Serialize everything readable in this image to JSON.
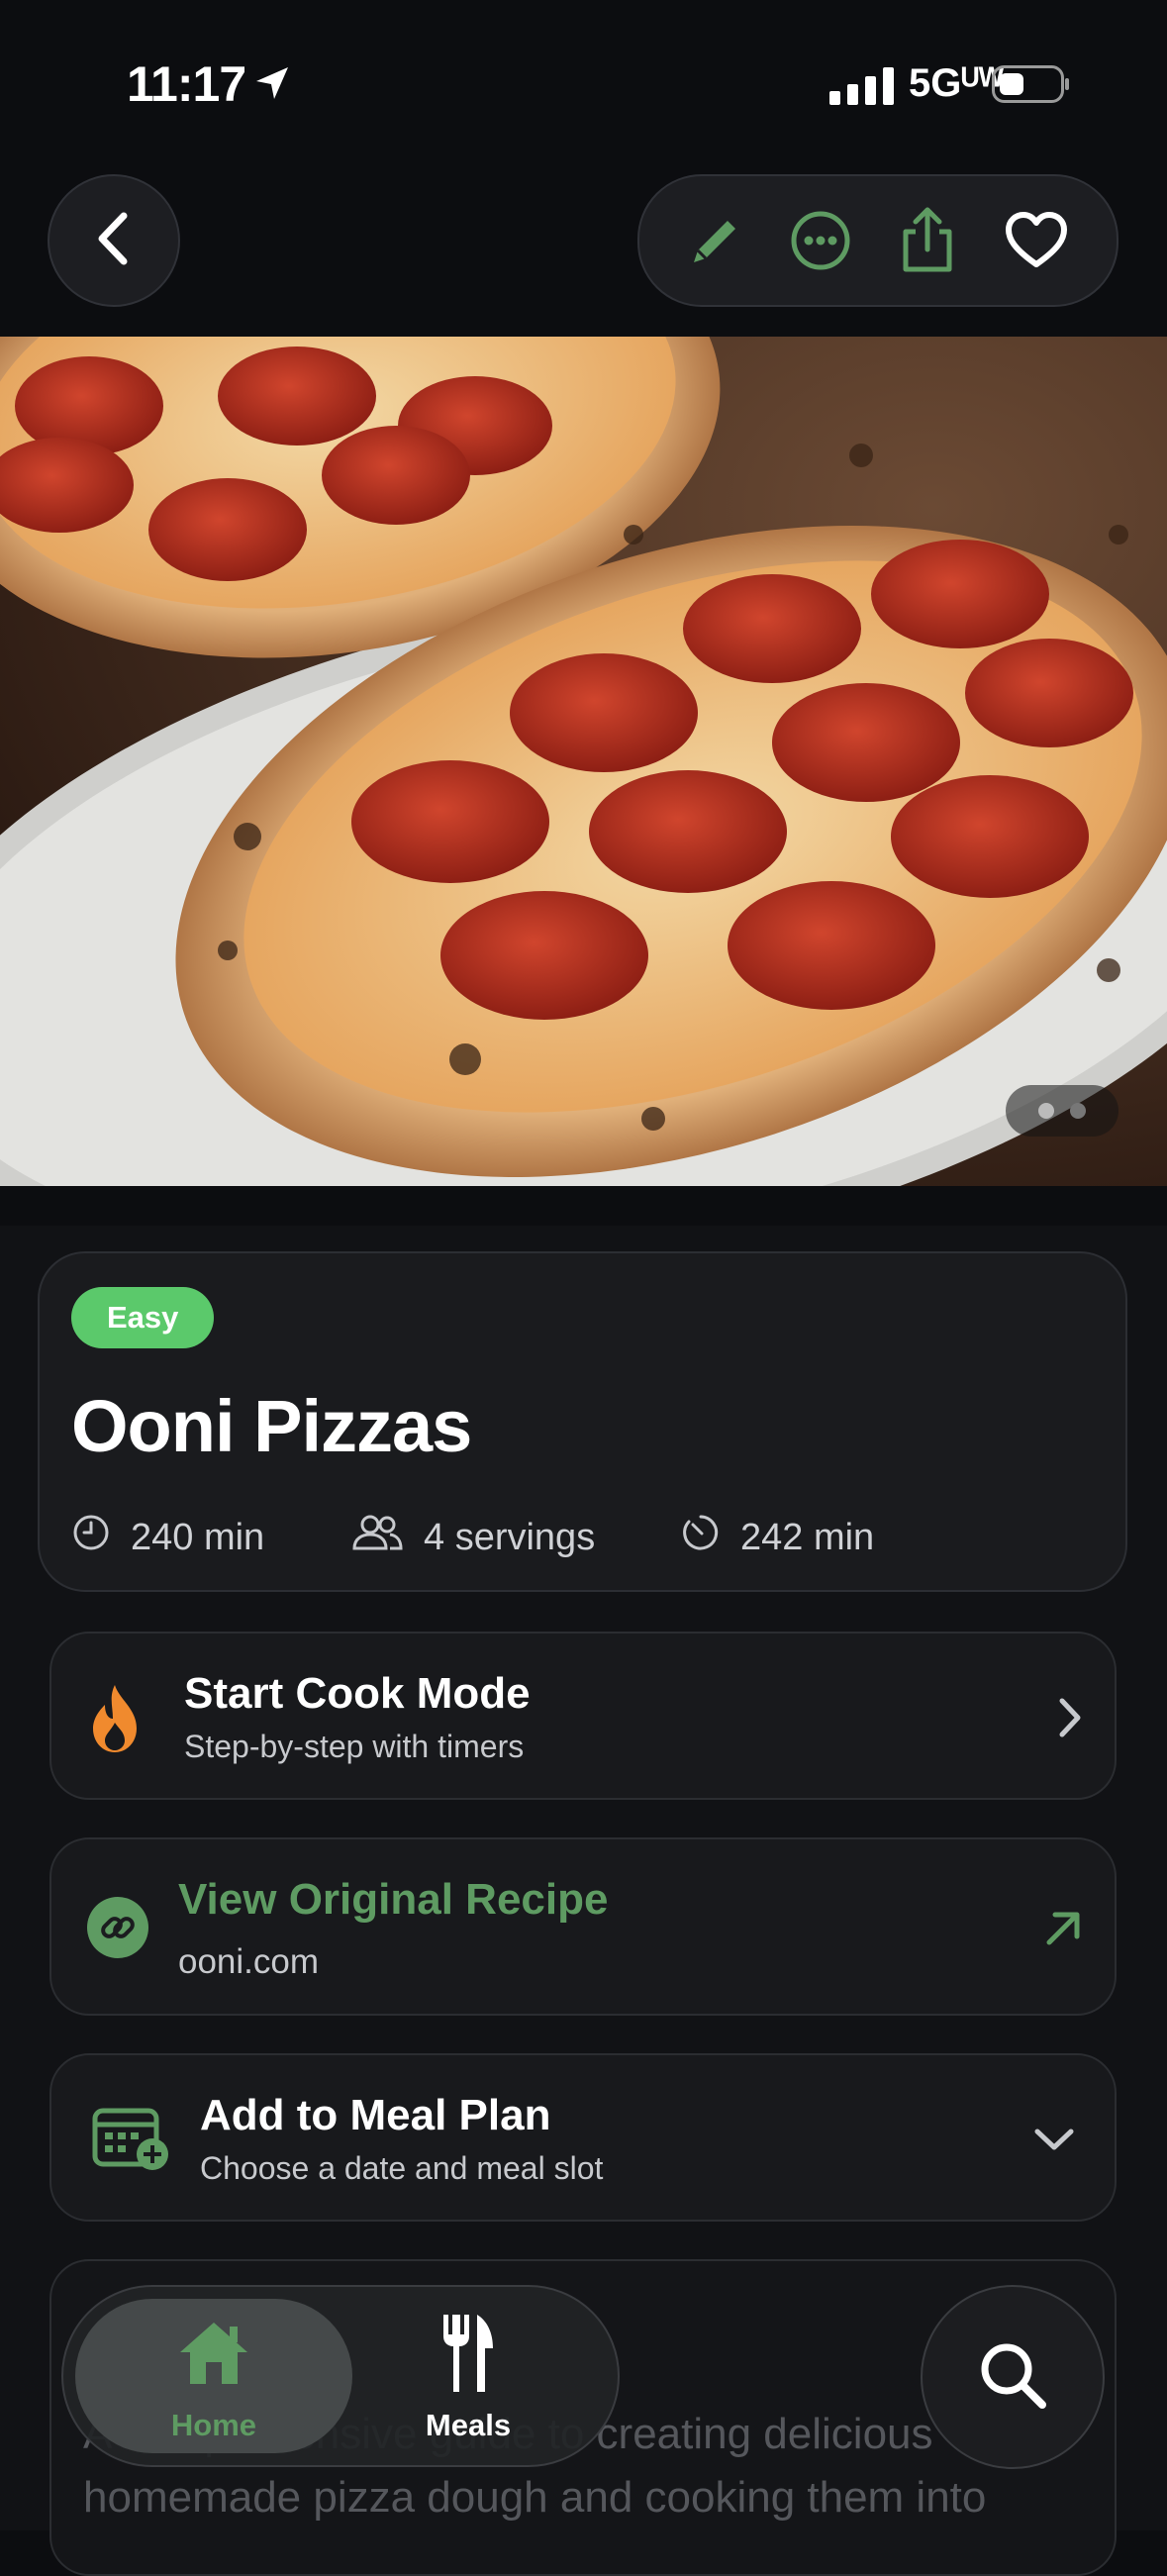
{
  "status_bar": {
    "time": "11:17",
    "network": "5Gᵁᵂ"
  },
  "recipe": {
    "difficulty": "Easy",
    "title": "Ooni Pizzas",
    "prep_time": "240 min",
    "servings": "4 servings",
    "total_time": "242 min"
  },
  "actions": {
    "cook_mode": {
      "title": "Start Cook Mode",
      "subtitle": "Step-by-step with timers"
    },
    "original": {
      "title": "View Original Recipe",
      "subtitle": "ooni.com"
    },
    "meal_plan": {
      "title": "Add to Meal Plan",
      "subtitle": "Choose a date and meal slot"
    }
  },
  "description_preview": {
    "line1": "A comprehensive guide to creating delicious",
    "line2": "homemade pizza dough and cooking them into"
  },
  "tabs": [
    {
      "label": "Home",
      "selected": true
    },
    {
      "label": "Meals",
      "selected": false
    }
  ],
  "icons": {
    "back": "chevron-left-icon",
    "edit": "pencil-icon",
    "more": "ellipsis-circle-icon",
    "share": "share-icon",
    "favorite": "heart-icon",
    "search": "search-icon"
  },
  "colors": {
    "accent_green": "#5e9b62",
    "badge_green": "#5bc96b",
    "flame_orange": "#f08a2e",
    "background": "#0c0d10"
  }
}
